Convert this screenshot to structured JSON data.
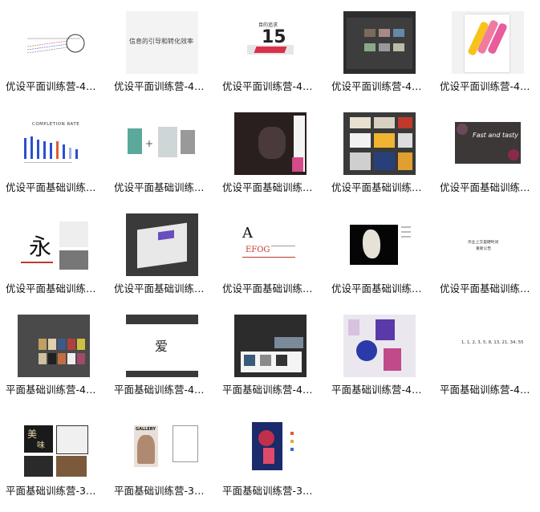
{
  "colors": {
    "orange": "#e25b2f",
    "blue": "#2b4fd0",
    "dark": "#2f2f2f",
    "gray": "#cccccc"
  },
  "tiles": [
    {
      "label": "优设平面训练营-4…"
    },
    {
      "label": "优设平面训练营-4…",
      "thumb_text": "信息的引导和转化效率"
    },
    {
      "label": "优设平面训练营-4…",
      "thumb_text": "目的追求",
      "thumb_num": "15"
    },
    {
      "label": "优设平面训练营-4…"
    },
    {
      "label": "优设平面训练营-4…"
    },
    {
      "label": "优设平面基础训练…",
      "thumb_text": "COMPLETION RATE"
    },
    {
      "label": "优设平面基础训练…"
    },
    {
      "label": "优设平面基础训练…"
    },
    {
      "label": "优设平面基础训练…"
    },
    {
      "label": "优设平面基础训练…",
      "thumb_text": "Fast and tasty"
    },
    {
      "label": "优设平面基础训练…",
      "thumb_text": "永"
    },
    {
      "label": "优设平面基础训练…"
    },
    {
      "label": "优设平面基础训练…",
      "thumb_text": "A",
      "thumb_text2": "EFOG"
    },
    {
      "label": "优设平面基础训练…"
    },
    {
      "label": "优设平面基础训练…",
      "thumb_text": "作业上交是硬时间",
      "thumb_text2": "重新公告"
    },
    {
      "label": "平面基础训练营-4…"
    },
    {
      "label": "平面基础训练营-4…",
      "thumb_text": "爱"
    },
    {
      "label": "平面基础训练营-4…"
    },
    {
      "label": "平面基础训练营-4…"
    },
    {
      "label": "平面基础训练营-4…",
      "thumb_text": "1, 1, 2, 3, 5, 8, 13, 21, 34, 55"
    },
    {
      "label": "平面基础训练营-3…",
      "thumb_text": "美",
      "thumb_text2": "味"
    },
    {
      "label": "平面基础训练营-3…",
      "thumb_text": "GALLERY"
    },
    {
      "label": "平面基础训练营-3…"
    }
  ]
}
